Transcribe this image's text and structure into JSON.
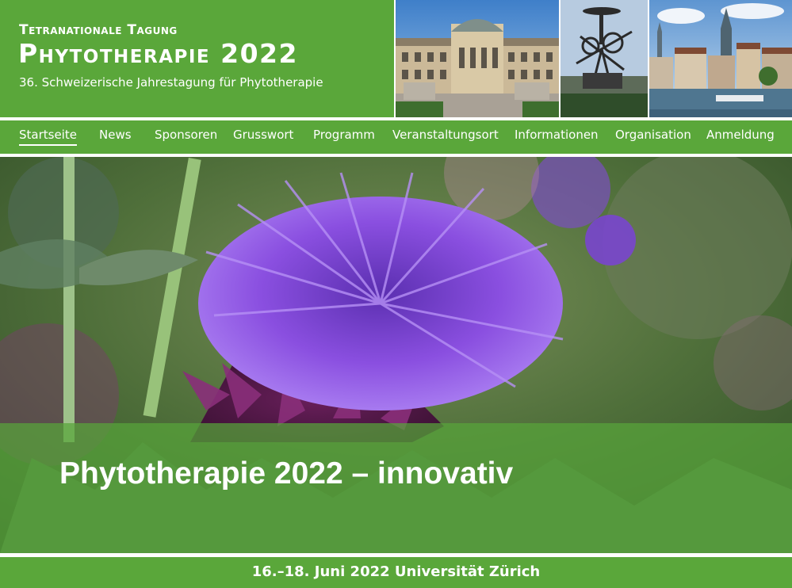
{
  "header": {
    "line1": "Tetranationale Tagung",
    "line2": "Phytotherapie 2022",
    "line3": "36. Schweizerische Jahrestagung für Phytotherapie"
  },
  "photos": [
    "university-building-photo",
    "fountain-sculpture-photo",
    "zurich-old-town-photo"
  ],
  "nav": {
    "items": [
      {
        "label": "Startseite",
        "active": true
      },
      {
        "label": "News"
      },
      {
        "label": "Sponsoren"
      },
      {
        "label": "Grusswort"
      },
      {
        "label": "Programm"
      },
      {
        "label": "Veranstaltungsort"
      },
      {
        "label": "Informationen"
      },
      {
        "label": "Organisation"
      },
      {
        "label": "Anmeldung"
      }
    ]
  },
  "hero": {
    "title": "Phytotherapie 2022 – innovativ",
    "image": "thistle-flower-photo"
  },
  "footer": {
    "text": "16.–18. Juni 2022 Universität Zürich"
  },
  "colors": {
    "brand_green": "#5aa73a",
    "flower_purple": "#7a3fd0",
    "text": "#ffffff"
  }
}
